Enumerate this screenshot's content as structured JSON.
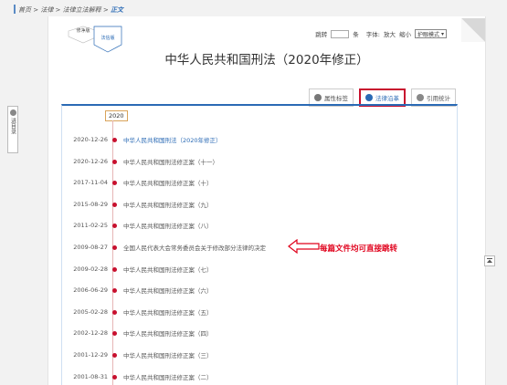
{
  "breadcrumb": {
    "path": "首页 > 法律 > 法律立法解释 > ",
    "current": "正文"
  },
  "versions": {
    "old_label": "修净版",
    "current_label": "法信版"
  },
  "toolbar": {
    "jump_label": "跳转",
    "jump_suffix": "条",
    "font_label": "字体:",
    "zoom_in": "放大",
    "zoom_out": "缩小",
    "mode_value": "护眼模式"
  },
  "document": {
    "title": "中华人民共和国刑法（2020年修正）"
  },
  "tabs": [
    {
      "label": "属性标签",
      "icon": "tag-icon",
      "active": false
    },
    {
      "label": "法律沿革",
      "icon": "history-icon",
      "active": true
    },
    {
      "label": "引用统计",
      "icon": "stats-icon",
      "active": false
    }
  ],
  "sidebar": {
    "label": "进目录"
  },
  "timeline": {
    "year": "2020",
    "items": [
      {
        "date": "2020-12-26",
        "title": "中华人民共和国刑法（2020年修正）",
        "highlight": true
      },
      {
        "date": "2020-12-26",
        "title": "中华人民共和国刑法修正案（十一）",
        "highlight": false
      },
      {
        "date": "2017-11-04",
        "title": "中华人民共和国刑法修正案（十）",
        "highlight": false
      },
      {
        "date": "2015-08-29",
        "title": "中华人民共和国刑法修正案（九）",
        "highlight": false
      },
      {
        "date": "2011-02-25",
        "title": "中华人民共和国刑法修正案（八）",
        "highlight": false
      },
      {
        "date": "2009-08-27",
        "title": "全国人民代表大会常务委员会关于修改部分法律的决定",
        "highlight": false
      },
      {
        "date": "2009-02-28",
        "title": "中华人民共和国刑法修正案（七）",
        "highlight": false
      },
      {
        "date": "2006-06-29",
        "title": "中华人民共和国刑法修正案（六）",
        "highlight": false
      },
      {
        "date": "2005-02-28",
        "title": "中华人民共和国刑法修正案（五）",
        "highlight": false
      },
      {
        "date": "2002-12-28",
        "title": "中华人民共和国刑法修正案（四）",
        "highlight": false
      },
      {
        "date": "2001-12-29",
        "title": "中华人民共和国刑法修正案（三）",
        "highlight": false
      },
      {
        "date": "2001-08-31",
        "title": "中华人民共和国刑法修正案（二）",
        "highlight": false
      }
    ]
  },
  "annotation": {
    "text": "每篇文件均可直接跳转",
    "color": "#e0001b"
  },
  "colors": {
    "accent": "#2a6ab5",
    "highlight_border": "#c8102e"
  }
}
